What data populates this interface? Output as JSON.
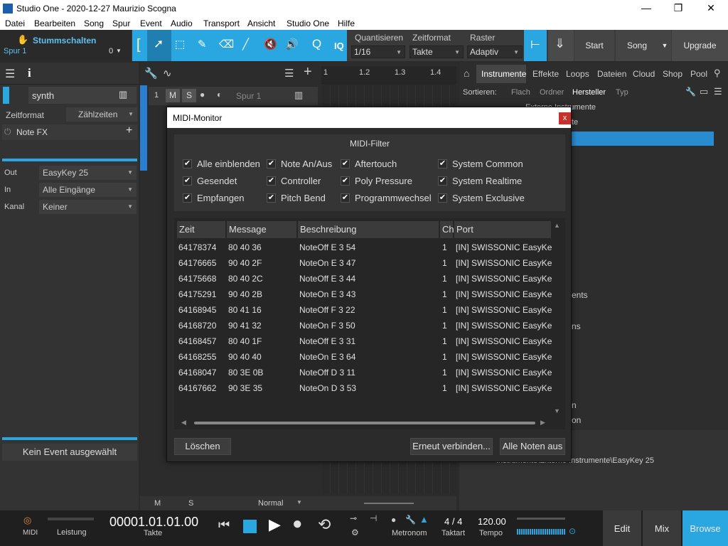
{
  "window": {
    "title": "Studio One - 2020-12-27 Maurizio Scogna",
    "min": "—",
    "max": "❐",
    "close": "✕"
  },
  "menu": [
    "Datei",
    "Bearbeiten",
    "Song",
    "Spur",
    "Event",
    "Audio",
    "Transport",
    "Ansicht",
    "Studio One",
    "Hilfe"
  ],
  "toolbar": {
    "mute_label": "Stummschalten",
    "track_label": "Spur 1",
    "track_count": "0",
    "quantize_label": "Quantisieren",
    "quantize_value": "1/16",
    "timeformat_label": "Zeitformat",
    "timeformat_value": "Takte",
    "grid_label": "Raster",
    "grid_value": "Adaptiv",
    "iq": "IQ",
    "start": "Start",
    "song": "Song",
    "upgrade": "Upgrade"
  },
  "left_panel": {
    "instrument": "synth",
    "timeformat_label": "Zeitformat",
    "timeformat_value": "Zählzeiten",
    "notefx": "Note FX",
    "out_label": "Out",
    "out_value": "EasyKey 25",
    "in_label": "In",
    "in_value": "Alle Eingänge",
    "channel_label": "Kanal",
    "channel_value": "Keiner",
    "no_event": "Kein Event ausgewählt"
  },
  "arrange": {
    "track_number": "1",
    "m": "M",
    "s": "S",
    "track_name": "Spur 1",
    "ruler": [
      "1",
      "1.2",
      "1.3",
      "1.4"
    ],
    "bottom_m": "M",
    "bottom_s": "S",
    "mode": "Normal"
  },
  "browser": {
    "tabs": [
      "Instrumente",
      "Effekte",
      "Loops",
      "Dateien",
      "Cloud",
      "Shop",
      "Pool"
    ],
    "sort_label": "Sortieren:",
    "sort_options": [
      "Flach",
      "Ordner",
      "Hersteller",
      "Typ"
    ],
    "breadcrumb_tail": "Externe Instrumente",
    "frag1": "te",
    "frag2": "ents",
    "frag3": "ns",
    "frag4": "n",
    "frag5": "on",
    "path": "Instrumente\\Externe Instrumente\\EasyKey 25"
  },
  "dialog": {
    "title": "MIDI-Monitor",
    "close": "x",
    "filter_title": "MIDI-Filter",
    "filters": [
      [
        "Alle einblenden",
        "Note An/Aus",
        "Aftertouch",
        "System Common"
      ],
      [
        "Gesendet",
        "Controller",
        "Poly Pressure",
        "System Realtime"
      ],
      [
        "Empfangen",
        "Pitch Bend",
        "Programmwechsel",
        "System Exclusive"
      ]
    ],
    "columns": [
      "Zeit",
      "Message",
      "Beschreibung",
      "Ch",
      "Port"
    ],
    "rows": [
      [
        "64178374",
        "80 40 36",
        "NoteOff E 3 54",
        "1",
        "[IN] SWISSONIC EasyKe"
      ],
      [
        "64176665",
        "90 40 2F",
        "NoteOn E 3 47",
        "1",
        "[IN] SWISSONIC EasyKe"
      ],
      [
        "64175668",
        "80 40 2C",
        "NoteOff E 3 44",
        "1",
        "[IN] SWISSONIC EasyKe"
      ],
      [
        "64175291",
        "90 40 2B",
        "NoteOn E 3 43",
        "1",
        "[IN] SWISSONIC EasyKe"
      ],
      [
        "64168945",
        "80 41 16",
        "NoteOff F 3 22",
        "1",
        "[IN] SWISSONIC EasyKe"
      ],
      [
        "64168720",
        "90 41 32",
        "NoteOn F 3 50",
        "1",
        "[IN] SWISSONIC EasyKe"
      ],
      [
        "64168457",
        "80 40 1F",
        "NoteOff E 3 31",
        "1",
        "[IN] SWISSONIC EasyKe"
      ],
      [
        "64168255",
        "90 40 40",
        "NoteOn E 3 64",
        "1",
        "[IN] SWISSONIC EasyKe"
      ],
      [
        "64168047",
        "80 3E 0B",
        "NoteOff D 3 11",
        "1",
        "[IN] SWISSONIC EasyKe"
      ],
      [
        "64167662",
        "90 3E 35",
        "NoteOn D 3 53",
        "1",
        "[IN] SWISSONIC EasyKe"
      ]
    ],
    "clear": "Löschen",
    "reconnect": "Erneut verbinden...",
    "all_notes_off": "Alle Noten aus"
  },
  "transport": {
    "midi": "MIDI",
    "performance": "Leistung",
    "time": "00001.01.01.00",
    "time_label": "Takte",
    "metronome": "Metronom",
    "signature": "4 / 4",
    "signature_label": "Taktart",
    "tempo": "120.00",
    "tempo_label": "Tempo",
    "edit": "Edit",
    "mix": "Mix",
    "browse": "Browse"
  },
  "colors": {
    "accent": "#2aa6e0",
    "close_red": "#c9302c"
  }
}
